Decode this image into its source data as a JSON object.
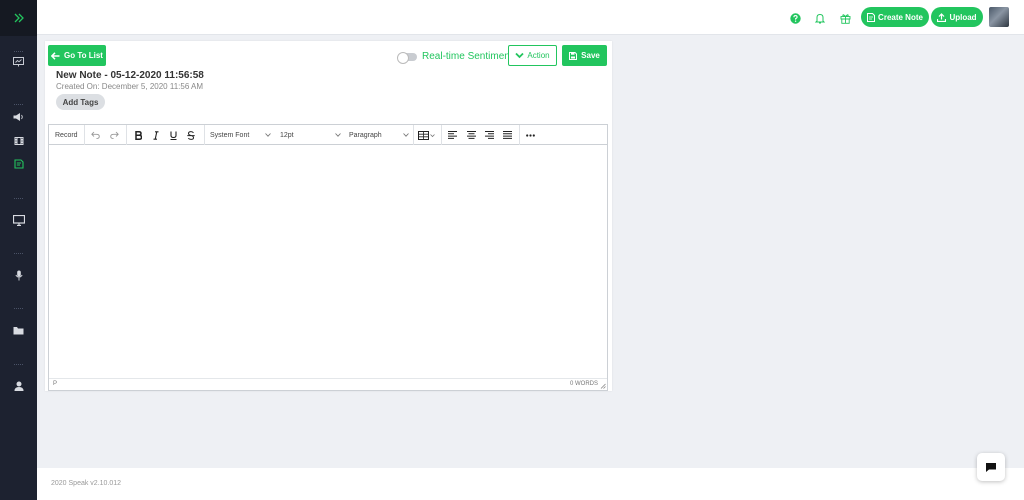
{
  "colors": {
    "accent": "#22c55e",
    "sidebar": "#1d2230"
  },
  "sidebar": {
    "items": [
      {
        "icon": "presentation-icon"
      },
      {
        "icon": "megaphone-icon"
      },
      {
        "icon": "film-icon"
      },
      {
        "icon": "notes-icon",
        "active": true
      },
      {
        "icon": "monitor-icon"
      },
      {
        "icon": "microphone-icon"
      },
      {
        "icon": "folder-icon"
      },
      {
        "icon": "user-icon"
      }
    ]
  },
  "header": {
    "create_note_label": "Create Note",
    "upload_label": "Upload"
  },
  "note": {
    "go_to_list_label": "Go To List",
    "sentiment_label": "Real-time Sentiment",
    "action_label": "Action",
    "save_label": "Save",
    "title": "New Note - 05-12-2020 11:56:58",
    "created_on": "Created On: December 5, 2020 11:56 AM",
    "add_tags_label": "Add Tags"
  },
  "editor": {
    "record_label": "Record",
    "font_family": "System Font",
    "font_size": "12pt",
    "block_format": "Paragraph",
    "status_path": "P",
    "word_count": "0 WORDS"
  },
  "footer": {
    "version_text": "2020 Speak v2.10.012"
  }
}
